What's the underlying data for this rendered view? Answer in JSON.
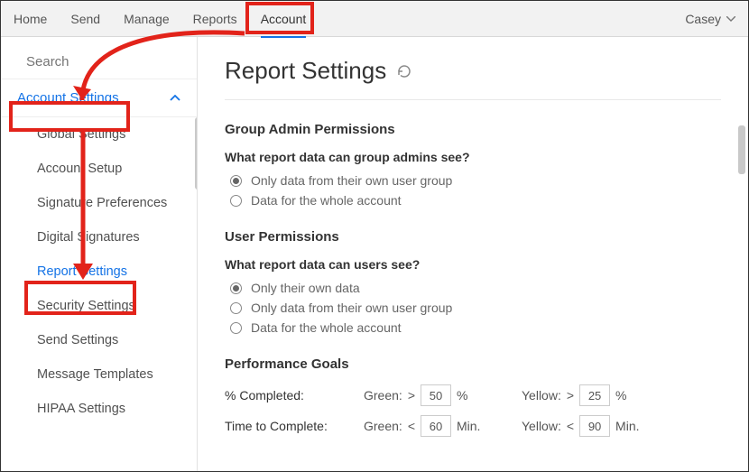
{
  "topnav": {
    "items": [
      "Home",
      "Send",
      "Manage",
      "Reports",
      "Account"
    ],
    "active_index": 4,
    "user": "Casey"
  },
  "sidebar": {
    "search_placeholder": "Search",
    "section_title": "Account Settings",
    "items": [
      "Global Settings",
      "Account Setup",
      "Signature Preferences",
      "Digital Signatures",
      "Report Settings",
      "Security Settings",
      "Send Settings",
      "Message Templates",
      "HIPAA Settings"
    ],
    "selected_index": 4
  },
  "page": {
    "title": "Report Settings",
    "sections": {
      "group_admin": {
        "heading": "Group Admin Permissions",
        "question": "What report data can group admins see?",
        "options": [
          "Only data from their own user group",
          "Data for the whole account"
        ],
        "selected_index": 0
      },
      "user_perm": {
        "heading": "User Permissions",
        "question": "What report data can users see?",
        "options": [
          "Only their own data",
          "Only data from their own user group",
          "Data for the whole account"
        ],
        "selected_index": 0
      },
      "perf": {
        "heading": "Performance Goals",
        "rows": [
          {
            "label": "% Completed:",
            "green_op": ">",
            "green_val": "50",
            "green_unit": "%",
            "yellow_op": ">",
            "yellow_val": "25",
            "yellow_unit": "%"
          },
          {
            "label": "Time to Complete:",
            "green_op": "<",
            "green_val": "60",
            "green_unit": "Min.",
            "yellow_op": "<",
            "yellow_val": "90",
            "yellow_unit": "Min."
          }
        ],
        "green_label": "Green:",
        "yellow_label": "Yellow:"
      }
    }
  },
  "annotations": {
    "color": "#e2231a"
  }
}
